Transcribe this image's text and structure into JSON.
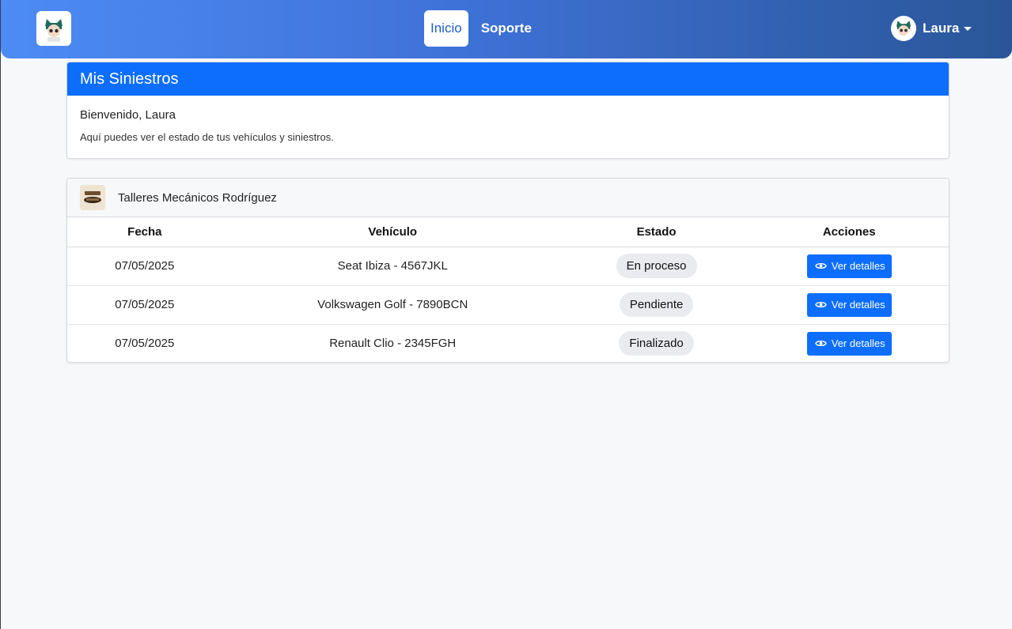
{
  "nav": {
    "brand_icon": "avatar-logo-icon",
    "links": [
      {
        "label": "Inicio",
        "active": true
      },
      {
        "label": "Soporte",
        "active": false
      }
    ],
    "user": {
      "name": "Laura",
      "icon": "chevron-down-icon"
    }
  },
  "welcome": {
    "title": "Mis Siniestros",
    "greeting": "Bienvenido, Laura",
    "subtitle": "Aquí puedes ver el estado de tus vehículos y siniestros."
  },
  "workshop": {
    "name": "Talleres Mecánicos Rodríguez",
    "columns": [
      "Fecha",
      "Vehículo",
      "Estado",
      "Acciones"
    ],
    "rows": [
      {
        "date": "07/05/2025",
        "vehicle": "Seat Ibiza - 4567JKL",
        "status": "En proceso",
        "action": "Ver detalles"
      },
      {
        "date": "07/05/2025",
        "vehicle": "Volkswagen Golf - 7890BCN",
        "status": "Pendiente",
        "action": "Ver detalles"
      },
      {
        "date": "07/05/2025",
        "vehicle": "Renault Clio - 2345FGH",
        "status": "Finalizado",
        "action": "Ver detalles"
      }
    ]
  },
  "colors": {
    "primary": "#0d6efd",
    "nav_gradient_start": "#4d8bf5",
    "nav_gradient_end": "#2a5698",
    "badge_bg": "#e9ebee"
  }
}
